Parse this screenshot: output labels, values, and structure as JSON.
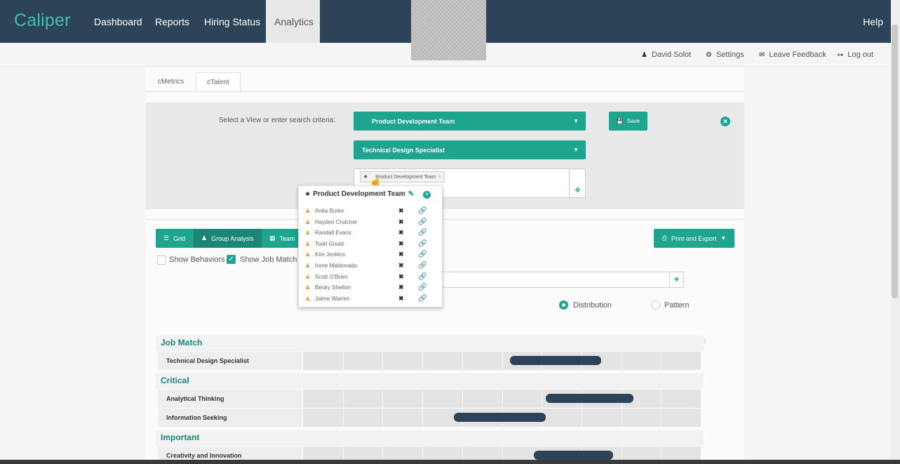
{
  "nav": {
    "brand": "Caliper",
    "items": [
      "Dashboard",
      "Reports",
      "Hiring Status",
      "Analytics"
    ],
    "active": "Analytics",
    "help": "Help"
  },
  "user_bar": {
    "user": "David Solot",
    "settings": "Settings",
    "feedback": "Leave Feedback",
    "logout": "Log out"
  },
  "tabs": [
    "cMetrics",
    "cTalent"
  ],
  "search": {
    "label": "Select a View or enter search criteria:",
    "view_select": "Product Development Team",
    "job_select": "Technical Design Specialist",
    "save_label": "Save",
    "tag_chip": "Product Development Team"
  },
  "popup": {
    "title": "Product Development Team",
    "members": [
      "Anita Burke",
      "Hayden Crutcher",
      "Randall Evans",
      "Todd Gould",
      "Kim Jenkins",
      "Irene Maldonado",
      "Scott O'Brien",
      "Becky Shelton",
      "Jaime Warren"
    ]
  },
  "toolbar": {
    "grid": "Grid",
    "group_analysis": "Group Analysis",
    "team": "Team",
    "print_export": "Print and Export",
    "show_behaviors": "Show Behaviors",
    "show_job_match": "Show Job Match",
    "distribution": "Distribution",
    "pattern": "Pattern",
    "selected_mode": "Distribution"
  },
  "chart": {
    "axis_ticks": [
      "0",
      "10",
      "20",
      "30",
      "40",
      "50",
      "60",
      "70",
      "80",
      "90",
      "100"
    ],
    "sections": [
      {
        "title": "Job Match",
        "rows": [
          {
            "label": "Technical Design Specialist",
            "min": 52,
            "max": 75
          }
        ]
      },
      {
        "title": "Critical",
        "rows": [
          {
            "label": "Analytical Thinking",
            "min": 61,
            "max": 83
          },
          {
            "label": "Information Seeking",
            "min": 38,
            "max": 61
          }
        ]
      },
      {
        "title": "Important",
        "rows": [
          {
            "label": "Creativity and Innovation",
            "min": 58,
            "max": 78
          }
        ]
      }
    ]
  },
  "colors": {
    "nav_bg": "#2d4458",
    "accent": "#1ea590",
    "bar": "#2d4458"
  }
}
